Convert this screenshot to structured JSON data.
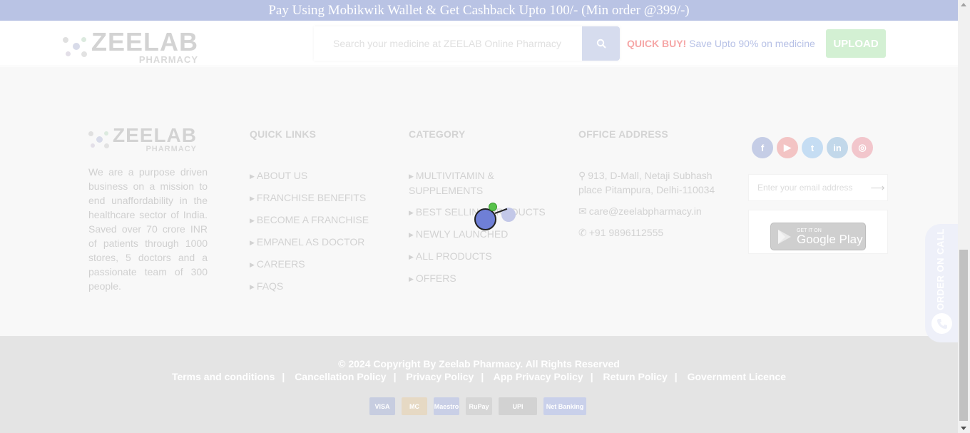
{
  "promo": {
    "text": "Pay Using Mobikwik Wallet & Get Cashback Upto 100/- (Min order @399/-)"
  },
  "header": {
    "logo_brand": "ZEELAB",
    "logo_sub": "PHARMACY",
    "search_placeholder": "Search your medicine at ZEELAB Online Pharmacy",
    "quick_buy": "QUICK BUY!",
    "quick_save": "Save Upto 90% on medicine",
    "upload_label": "UPLOAD"
  },
  "footer": {
    "logo_brand": "ZEELAB",
    "logo_sub": "PHARMACY",
    "about": "We are a purpose driven business on a mission to end unaffordability in the healthcare sector of India. Saved over 70 crore INR of patients through 1000 stores, 5 doctors and a passionate team of 300 people.",
    "quick_links": {
      "title": "QUICK LINKS",
      "items": [
        "ABOUT US",
        "FRANCHISE BENEFITS",
        "BECOME A FRANCHISE",
        "EMPANEL AS DOCTOR",
        "CAREERS",
        "FAQS"
      ]
    },
    "category": {
      "title": "CATEGORY",
      "items": [
        "MULTIVITAMIN & SUPPLEMENTS",
        "BEST SELLING PRODUCTS",
        "NEWLY LAUNCHED",
        "ALL PRODUCTS",
        "OFFERS"
      ]
    },
    "office": {
      "title": "OFFICE ADDRESS",
      "address": "913, D-Mall, Netaji Subhash place Pitampura, Delhi-110034",
      "email": "care@zeelabpharmacy.in",
      "phone": "+91 9896112555"
    },
    "socials": [
      {
        "name": "facebook-icon",
        "glyph": "f",
        "color": "#c5cde6"
      },
      {
        "name": "youtube-icon",
        "glyph": "▶",
        "color": "#f3c4c4"
      },
      {
        "name": "twitter-icon",
        "glyph": "t",
        "color": "#c5ddf3"
      },
      {
        "name": "linkedin-icon",
        "glyph": "in",
        "color": "#c2d8ea"
      },
      {
        "name": "instagram-icon",
        "glyph": "◎",
        "color": "#f2c6cc"
      }
    ],
    "email_placeholder": "Enter your email address",
    "gplay_small": "GET IT ON",
    "gplay_big": "Google Play"
  },
  "order_on_call": {
    "label": "ORDER ON CALL"
  },
  "bottom": {
    "copyright": "© 2024 Copyright By Zeelab Pharmacy. All Rights Reserved",
    "links": [
      "Terms and conditions",
      "Cancellation Policy",
      "Privacy Policy",
      "App Privacy Policy",
      "Return Policy",
      "Government Licence"
    ],
    "separator": "|",
    "payments": [
      {
        "name": "visa-logo",
        "label": "VISA",
        "color": "#c7cde0"
      },
      {
        "name": "mastercard-logo",
        "label": "MC",
        "color": "#e6d9c4"
      },
      {
        "name": "maestro-logo",
        "label": "Maestro",
        "color": "#c9cfe6"
      },
      {
        "name": "rupay-logo",
        "label": "RuPay",
        "color": "#d6d6d6"
      },
      {
        "name": "upi-logo",
        "label": "UPI",
        "color": "#d2d2d2"
      },
      {
        "name": "netbanking-logo",
        "label": "Net Banking",
        "color": "#c9d0ea"
      }
    ]
  }
}
